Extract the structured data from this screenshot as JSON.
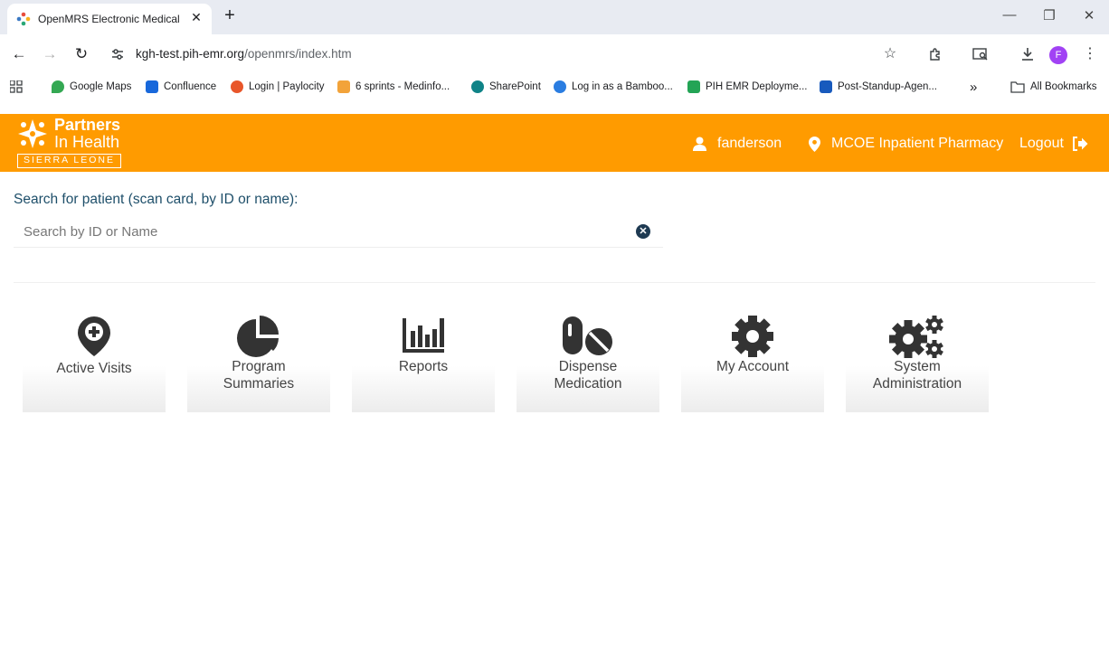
{
  "browser": {
    "tab_title": "OpenMRS Electronic Medical R",
    "tab_close": "✕",
    "new_tab": "+",
    "url_host": "kgh-test.pih-emr.org",
    "url_path": "/openmrs/index.htm",
    "profile_initial": "F",
    "bookmarks": [
      {
        "label": "Google Maps",
        "color": "#34a853"
      },
      {
        "label": "Confluence",
        "color": "#1868db"
      },
      {
        "label": "Login | Paylocity",
        "color": "#e8562a"
      },
      {
        "label": "6 sprints - Medinfo...",
        "color": "#f2a33a"
      },
      {
        "label": "SharePoint",
        "color": "#0f8387"
      },
      {
        "label": "Log in as a Bamboo...",
        "color": "#2a7de1"
      },
      {
        "label": "PIH EMR Deployme...",
        "color": "#23a455"
      },
      {
        "label": "Post-Standup-Agen...",
        "color": "#185abd"
      }
    ],
    "more_bookmarks": "»",
    "all_bookmarks": "All Bookmarks"
  },
  "header": {
    "logo_line1": "Partners",
    "logo_line2": "In Health",
    "logo_sub": "SIERRA LEONE",
    "user": "fanderson",
    "location": "MCOE Inpatient Pharmacy",
    "logout": "Logout",
    "bg_color": "#ff9b00"
  },
  "search": {
    "label": "Search for patient (scan card, by ID or name):",
    "placeholder": "Search by ID or Name",
    "value": "",
    "clear": "✕"
  },
  "apps": [
    {
      "line1": "Active Visits",
      "line2": "",
      "icon": "map-marker-icon"
    },
    {
      "line1": "Program",
      "line2": "Summaries",
      "icon": "pie-chart-icon"
    },
    {
      "line1": "Reports",
      "line2": "",
      "icon": "bar-chart-icon"
    },
    {
      "line1": "Dispense",
      "line2": "Medication",
      "icon": "pills-icon"
    },
    {
      "line1": "My Account",
      "line2": "",
      "icon": "gear-icon"
    },
    {
      "line1": "System",
      "line2": "Administration",
      "icon": "gears-icon"
    }
  ]
}
